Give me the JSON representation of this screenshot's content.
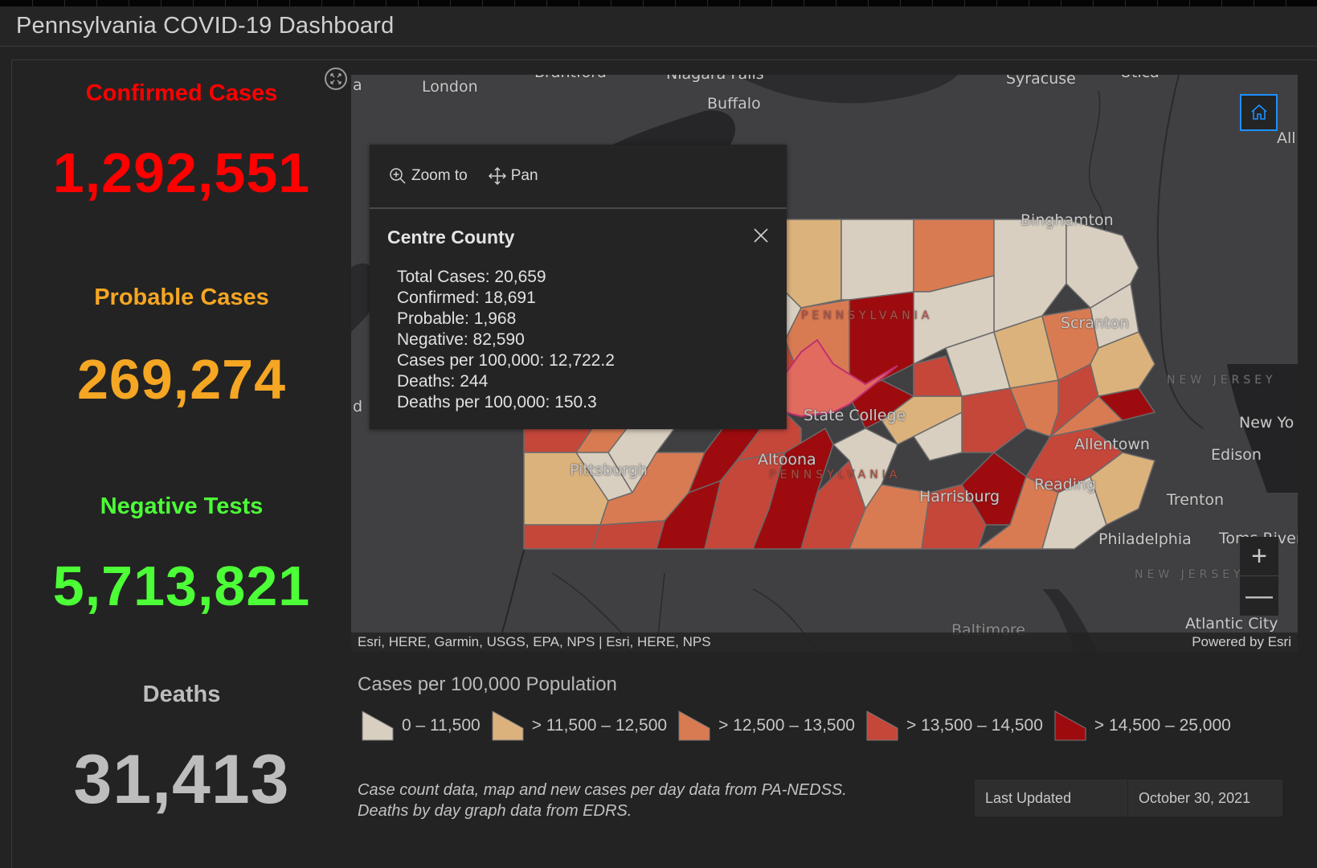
{
  "header": {
    "title": "Pennsylvania COVID-19 Dashboard"
  },
  "stats": [
    {
      "label": "Confirmed Cases",
      "value": "1,292,551",
      "color": "#ff0000"
    },
    {
      "label": "Probable Cases",
      "value": "269,274",
      "color": "#f5a623"
    },
    {
      "label": "Negative Tests",
      "value": "5,713,821",
      "color": "#4cff37"
    },
    {
      "label": "Deaths",
      "value": "31,413",
      "color": "#bdbdbd"
    }
  ],
  "map": {
    "labels": {
      "london": "London",
      "buffalo": "Buffalo",
      "brantford": "Brantford",
      "niagara": "Niagara Falls",
      "syracuse": "Syracuse",
      "utica": "Utica",
      "albany": "All",
      "binghamton": "Binghamton",
      "scranton": "Scranton",
      "state_college": "State College",
      "altoona": "Altoona",
      "pittsburgh": "Pittsburgh",
      "harrisburg": "Harrisburg",
      "reading": "Reading",
      "allentown": "Allentown",
      "philadelphia": "Philadelphia",
      "trenton": "Trenton",
      "edison": "Edison",
      "new_york": "New Yo",
      "toms_river": "Toms River",
      "atlantic_city": "Atlantic City",
      "baltimore": "Baltimore",
      "new_jersey_1": "NEW JERSEY",
      "new_jersey_2": "NEW JERSEY",
      "pennsylvania_1": "PENNSYLVANIA",
      "pennsylvania_2": "PENNSYLVANIA",
      "edge_a": "a",
      "edge_d": "d"
    },
    "attribution": "Esri, HERE, Garmin, USGS, EPA, NPS | Esri, HERE, NPS",
    "powered_by": "Powered by Esri",
    "zoom_in": "+",
    "zoom_out": "—"
  },
  "popup": {
    "actions": {
      "zoom_to": "Zoom to",
      "pan": "Pan"
    },
    "title": "Centre County",
    "fields": [
      "Total Cases: 20,659",
      "Confirmed: 18,691",
      "Probable: 1,968",
      "Negative: 82,590",
      "Cases per 100,000: 12,722.2",
      "Deaths: 244",
      "Deaths per 100,000: 150.3"
    ]
  },
  "legend": {
    "title": "Cases per 100,000 Population",
    "classes": [
      {
        "label": "0 – 11,500",
        "color": "#d9cfc0"
      },
      {
        "label": "> 11,500 – 12,500",
        "color": "#dcb27c"
      },
      {
        "label": "> 12,500 – 13,500",
        "color": "#d97b52"
      },
      {
        "label": "> 13,500 – 14,500",
        "color": "#c5473a"
      },
      {
        "label": "> 14,500 – 25,000",
        "color": "#9e0b0e"
      }
    ]
  },
  "footer": {
    "note_line1": "Case count data, map and new cases per day data from PA-NEDSS.",
    "note_line2": "Deaths by day graph data from EDRS.",
    "last_updated_label": "Last Updated",
    "last_updated_value": "October 30, 2021"
  },
  "colors": {
    "highlight": "#e06b5e",
    "accent_blue": "#1e90ff"
  }
}
